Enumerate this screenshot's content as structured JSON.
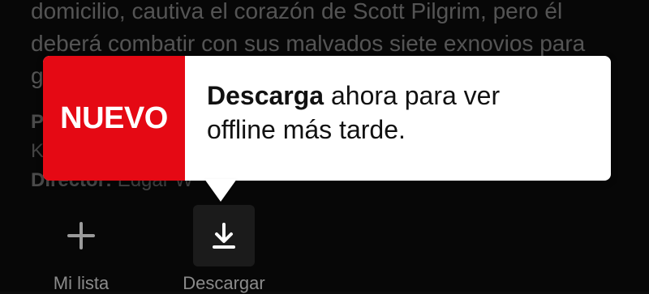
{
  "background": {
    "synopsis": [
      "domicilio, cautiva el corazón de Scott Pilgrim, pero él",
      "deberá combatir con sus malvados siete exnovios para",
      "g"
    ],
    "meta": {
      "line1_prefix": "P",
      "line2_prefix": "K",
      "director_label": "Director:",
      "director_value": "Edgar W"
    }
  },
  "tooltip": {
    "badge_label": "NUEVO",
    "message_bold": "Descarga",
    "message_line1_rest": " ahora para ver",
    "message_line2": "offline más tarde."
  },
  "actions": {
    "my_list": {
      "label": "Mi lista",
      "icon": "plus-icon"
    },
    "download": {
      "label": "Descargar",
      "icon": "download-icon"
    }
  },
  "colors": {
    "accent": "#E50914",
    "background": "#0C0C0C",
    "text": "#FFFFFF",
    "muted": "#8D8D8D"
  }
}
